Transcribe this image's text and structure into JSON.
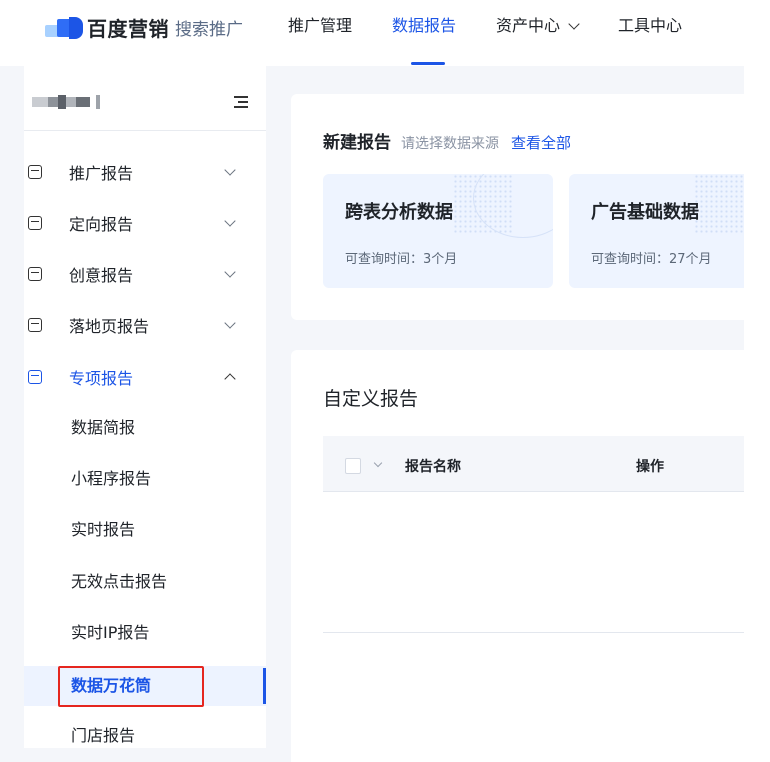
{
  "header": {
    "brand": "百度营销",
    "product": "搜索推广",
    "nav": [
      {
        "label": "推广管理"
      },
      {
        "label": "数据报告"
      },
      {
        "label": "资产中心"
      },
      {
        "label": "工具中心"
      }
    ]
  },
  "sidebar": {
    "menu": [
      {
        "label": "推广报告"
      },
      {
        "label": "定向报告"
      },
      {
        "label": "创意报告"
      },
      {
        "label": "落地页报告"
      },
      {
        "label": "专项报告"
      }
    ],
    "submenu": [
      {
        "label": "数据简报"
      },
      {
        "label": "小程序报告"
      },
      {
        "label": "实时报告"
      },
      {
        "label": "无效点击报告"
      },
      {
        "label": "实时IP报告"
      },
      {
        "label": "数据万花筒"
      },
      {
        "label": "门店报告"
      }
    ]
  },
  "new_report": {
    "title": "新建报告",
    "hint": "请选择数据来源",
    "view_all": "查看全部",
    "sources": [
      {
        "title": "跨表分析数据",
        "desc": "可查询时间：3个月"
      },
      {
        "title": "广告基础数据",
        "desc": "可查询时间：27个月"
      }
    ]
  },
  "custom_report": {
    "title": "自定义报告",
    "columns": [
      "报告名称",
      "操作"
    ]
  },
  "colors": {
    "accent": "#1c55e6",
    "highlight_box": "#e5261f"
  }
}
